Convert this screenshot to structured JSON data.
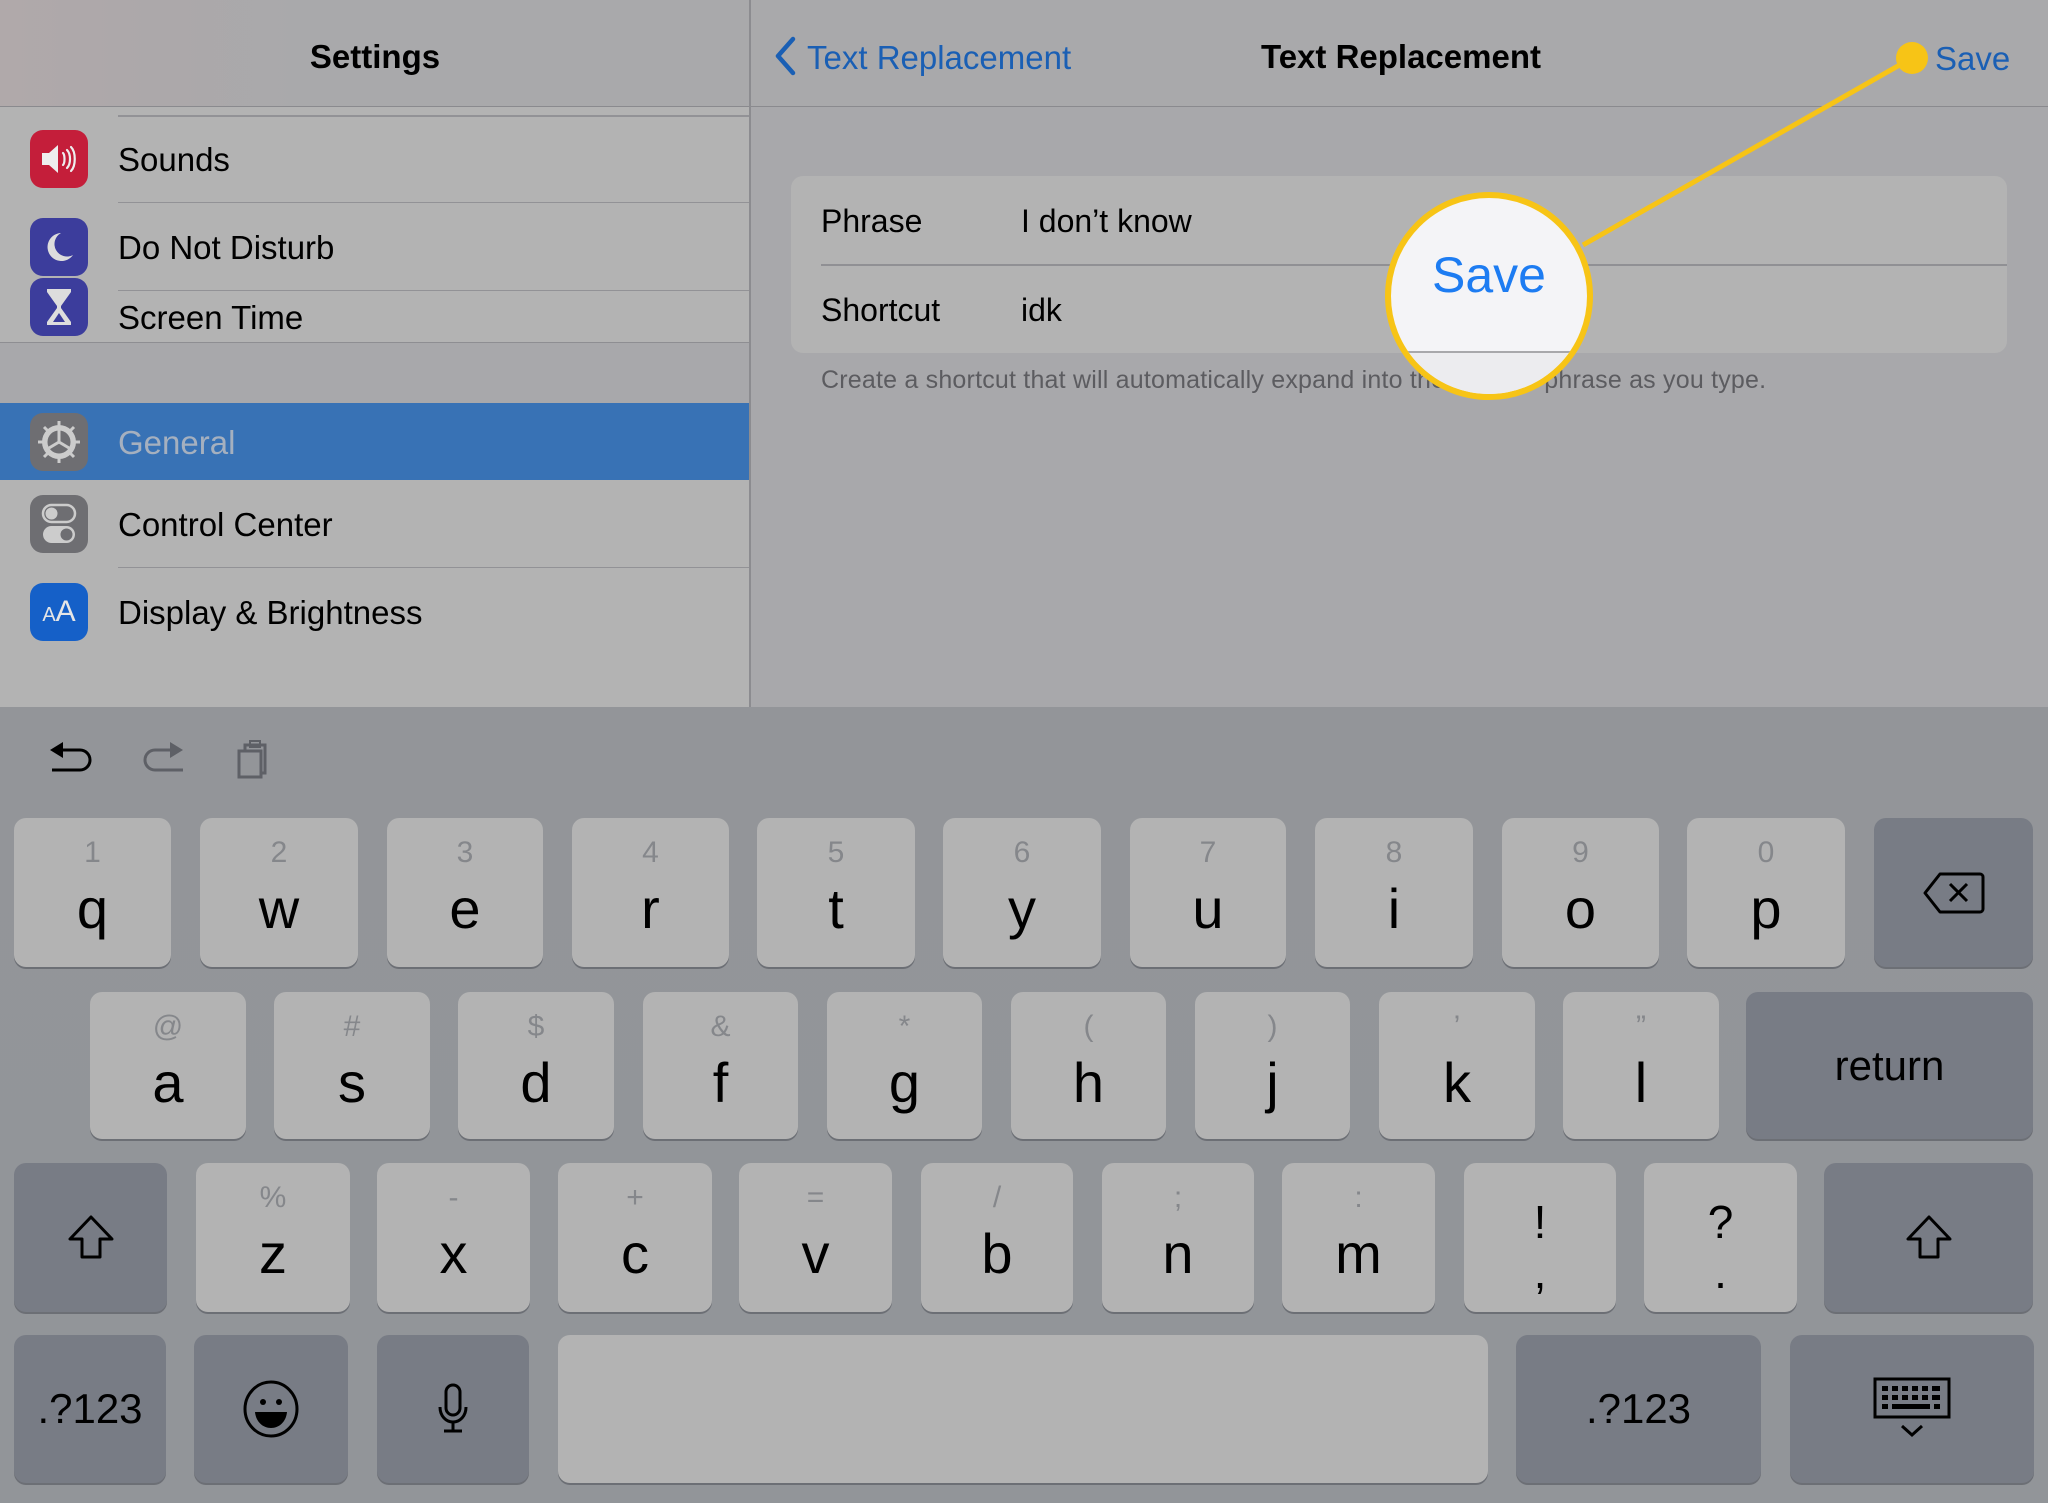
{
  "sidebar": {
    "title": "Settings",
    "group1": [
      {
        "label": "Sounds",
        "icon": "speaker-icon",
        "color": "#c41e3a"
      },
      {
        "label": "Do Not Disturb",
        "icon": "moon-icon",
        "color": "#3c3d9c"
      },
      {
        "label": "Screen Time",
        "icon": "hourglass-icon",
        "color": "#3c3d9c"
      }
    ],
    "group2": [
      {
        "label": "General",
        "icon": "gear-icon",
        "color": "#6e6e72",
        "selected": true
      },
      {
        "label": "Control Center",
        "icon": "toggles-icon",
        "color": "#6e6e72"
      },
      {
        "label": "Display & Brightness",
        "icon": "text-size-icon",
        "color": "#1560c8",
        "glyph": "AA"
      }
    ],
    "selected_color": "#3872b5"
  },
  "detail": {
    "back_label": "Text Replacement",
    "title": "Text Replacement",
    "save_label": "Save",
    "fields": [
      {
        "label": "Phrase",
        "value": "I don’t know"
      },
      {
        "label": "Shortcut",
        "value": "idk"
      }
    ],
    "helper_text": "Create a shortcut that will automatically expand into the word or phrase as you type."
  },
  "callout": {
    "text": "Save",
    "color": "#f7c416"
  },
  "keyboard": {
    "toolbar": [
      {
        "name": "undo-icon"
      },
      {
        "name": "redo-icon"
      },
      {
        "name": "paste-icon"
      }
    ],
    "row1": [
      {
        "pri": "q",
        "sec": "1"
      },
      {
        "pri": "w",
        "sec": "2"
      },
      {
        "pri": "e",
        "sec": "3"
      },
      {
        "pri": "r",
        "sec": "4"
      },
      {
        "pri": "t",
        "sec": "5"
      },
      {
        "pri": "y",
        "sec": "6"
      },
      {
        "pri": "u",
        "sec": "7"
      },
      {
        "pri": "i",
        "sec": "8"
      },
      {
        "pri": "o",
        "sec": "9"
      },
      {
        "pri": "p",
        "sec": "0"
      }
    ],
    "row2": [
      {
        "pri": "a",
        "sec": "@"
      },
      {
        "pri": "s",
        "sec": "#"
      },
      {
        "pri": "d",
        "sec": "$"
      },
      {
        "pri": "f",
        "sec": "&"
      },
      {
        "pri": "g",
        "sec": "*"
      },
      {
        "pri": "h",
        "sec": "("
      },
      {
        "pri": "j",
        "sec": ")"
      },
      {
        "pri": "k",
        "sec": "’"
      },
      {
        "pri": "l",
        "sec": "”"
      }
    ],
    "row3": [
      {
        "pri": "z",
        "sec": "%"
      },
      {
        "pri": "x",
        "sec": "-"
      },
      {
        "pri": "c",
        "sec": "+"
      },
      {
        "pri": "v",
        "sec": "="
      },
      {
        "pri": "b",
        "sec": "/"
      },
      {
        "pri": "n",
        "sec": ";"
      },
      {
        "pri": "m",
        "sec": ":"
      }
    ],
    "punct": [
      {
        "top": "!",
        "bottom": ","
      },
      {
        "top": "?",
        "bottom": "."
      }
    ],
    "return_label": "return",
    "numbers_label": ".?123"
  }
}
